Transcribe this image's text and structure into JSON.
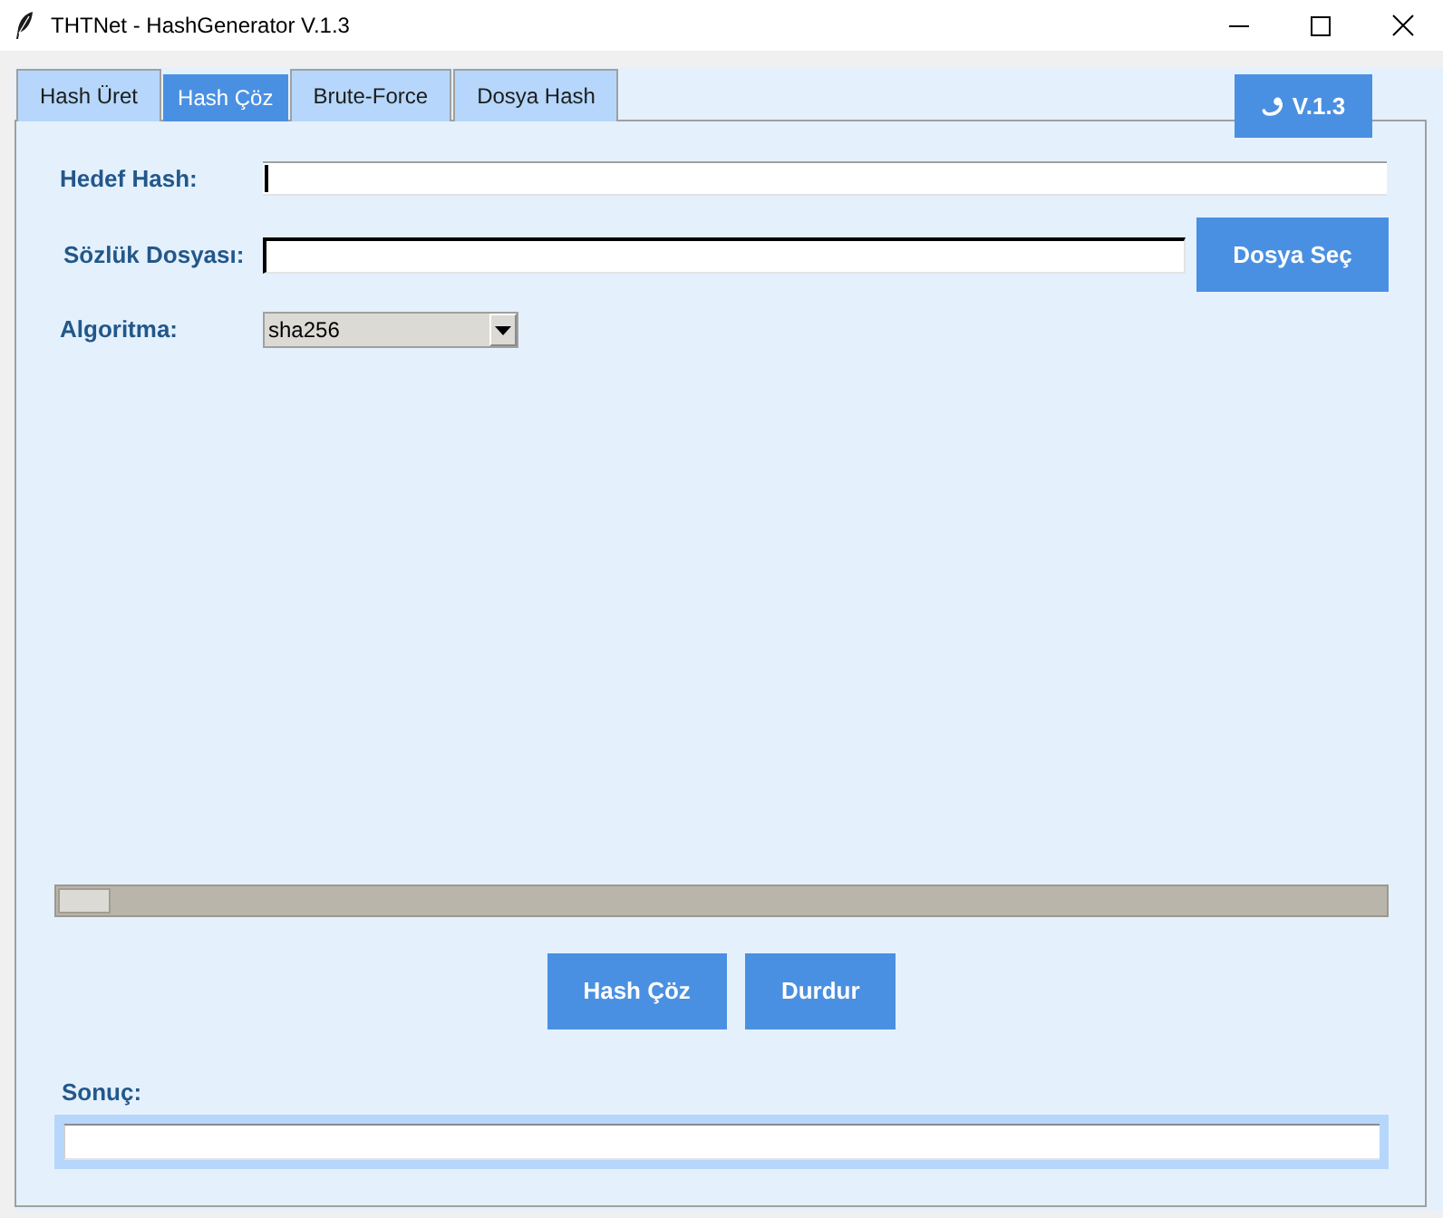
{
  "window": {
    "title": "THTNet - HashGenerator V.1.3"
  },
  "tabs": [
    {
      "label": "Hash Üret",
      "selected": false
    },
    {
      "label": "Hash Çöz",
      "selected": true
    },
    {
      "label": "Brute-Force",
      "selected": false
    },
    {
      "label": "Dosya Hash",
      "selected": false
    }
  ],
  "version_button": {
    "label": "V.1.3"
  },
  "form": {
    "target_hash": {
      "label": "Hedef Hash:",
      "focused": true
    },
    "dictionary_file": {
      "label": "Sözlük Dosyası:",
      "button": "Dosya Seç"
    },
    "algorithm": {
      "label": "Algoritma:",
      "value": "sha256"
    }
  },
  "progress": {
    "level": 0.04
  },
  "buttons": [
    "Hash Çöz",
    "Durdur"
  ],
  "result": {
    "label": "Sonuç:"
  }
}
